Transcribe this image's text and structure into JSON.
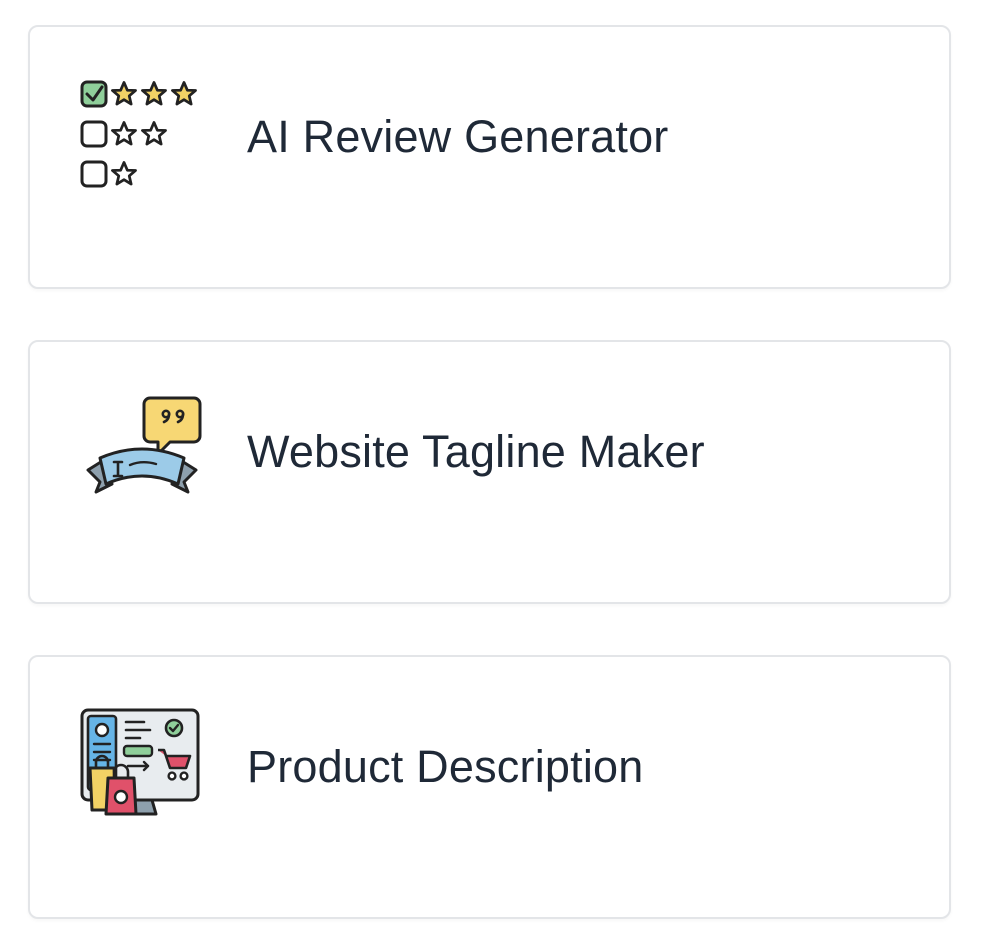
{
  "cards": [
    {
      "title": "AI Review Generator",
      "icon": "star-rating-checklist-icon"
    },
    {
      "title": "Website Tagline Maker",
      "icon": "quote-banner-icon"
    },
    {
      "title": "Product Description",
      "icon": "ecommerce-monitor-icon"
    }
  ],
  "colors": {
    "title_text": "#1f2937",
    "card_border": "#e3e5e8",
    "star_yellow": "#f2d265",
    "check_green": "#8fcf9a",
    "bubble_yellow": "#f7d774",
    "ribbon_blue": "#9ccbe8",
    "ribbon_gray": "#8ea0ad",
    "bag_yellow": "#f2d265",
    "bag_red": "#e0516a",
    "panel_blue": "#66b4e6"
  }
}
